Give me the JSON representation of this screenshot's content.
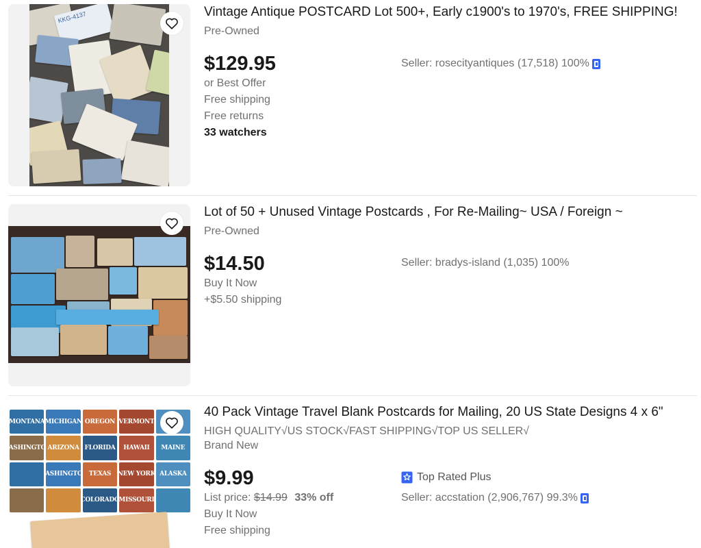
{
  "listings": [
    {
      "title": "Vintage Antique POSTCARD Lot 500+, Early c1900's to 1970's, FREE SHIPPING!",
      "condition": "Pre-Owned",
      "price": "$129.95",
      "lines": [
        "or Best Offer",
        "Free shipping",
        "Free returns"
      ],
      "watchers": "33 watchers",
      "seller": "Seller: rosecityantiques (17,518) 100%",
      "seller_icon": "verified-seller-icon",
      "image_label": "KKG-4137"
    },
    {
      "title": "Lot of 50 + Unused Vintage Postcards , For Re-Mailing~ USA / Foreign ~",
      "condition": "Pre-Owned",
      "price": "$14.50",
      "lines": [
        "Buy It Now",
        "+$5.50 shipping"
      ],
      "seller": "Seller: bradys-island (1,035) 100%"
    },
    {
      "title": "40 Pack Vintage Travel Blank Postcards for Mailing, 20 US State Designs 4 x 6\"",
      "subtitle": "HIGH QUALITY√US STOCK√FAST SHIPPING√TOP US SELLER√",
      "condition": "Brand New",
      "price": "$9.99",
      "list_price_label": "List price:",
      "list_price": "$14.99",
      "discount": "33% off",
      "lines": [
        "Buy It Now",
        "Free shipping"
      ],
      "top_rated": "Top Rated Plus",
      "top_rated_icon": "top-rated-badge-icon",
      "seller": "Seller: accstation (2,906,767) 99.3%",
      "seller_icon": "verified-seller-icon",
      "states": [
        "MONTANA",
        "MICHIGAN",
        "OREGON",
        "VERMONT",
        "",
        "WASHINGTON",
        "ARIZONA",
        "FLORIDA",
        "HAWAII",
        "MAINE",
        "",
        "WASHINGTON",
        "TEXAS",
        "NEW YORK",
        "ALASKA",
        "",
        "",
        "COLORADO",
        "MISSOURI",
        ""
      ]
    }
  ],
  "colors": {
    "text": "#191919",
    "muted": "#707070",
    "badge_blue": "#3665f3",
    "separator": "#e5e5e5"
  }
}
